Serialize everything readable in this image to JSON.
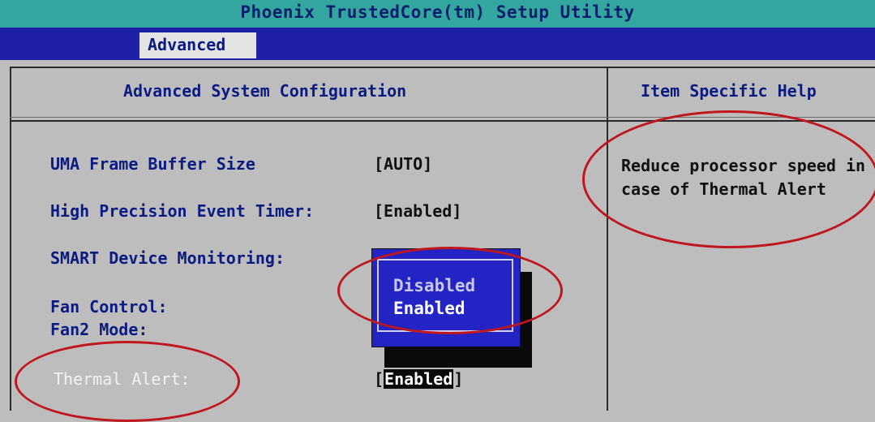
{
  "app": {
    "title": "Phoenix TrustedCore(tm) Setup Utility",
    "active_tab": "Advanced"
  },
  "main_panel": {
    "title": "Advanced System Configuration",
    "settings": [
      {
        "label": "UMA Frame Buffer Size",
        "value": "[AUTO]"
      },
      {
        "label": "High Precision Event Timer:",
        "value": "[Enabled]"
      },
      {
        "label": "SMART Device Monitoring:",
        "value": ""
      },
      {
        "label": "Fan Control:",
        "value": ""
      },
      {
        "label": "Fan2 Mode:",
        "value": ""
      },
      {
        "label": "Thermal Alert:",
        "value_open": "[",
        "value_text": "Enabled",
        "value_close": "]"
      }
    ]
  },
  "popup": {
    "options": [
      "Disabled",
      "Enabled"
    ],
    "selected": "Enabled"
  },
  "help_panel": {
    "title": "Item Specific Help",
    "text": "Reduce processor speed in case of Thermal Alert"
  },
  "colors": {
    "background": "#bdbdbd",
    "header_teal": "#33a6a0",
    "menubar_blue": "#1f1fa8",
    "label_blue": "#0c1b80",
    "popup_blue": "#2424c4",
    "annotation_red": "#c0161d"
  }
}
